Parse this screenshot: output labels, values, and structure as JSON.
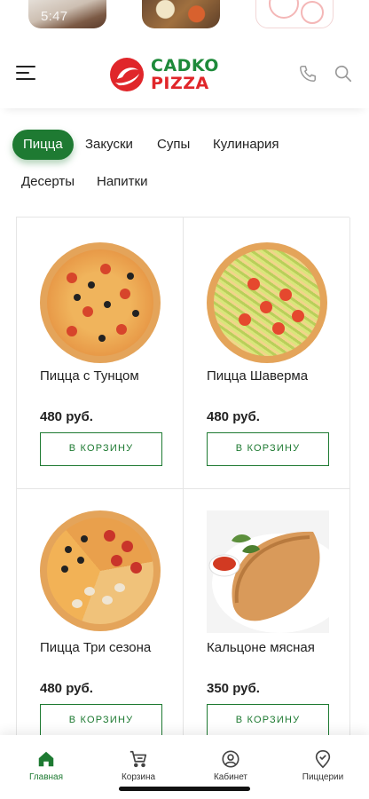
{
  "status_bar": {
    "time": "5:47"
  },
  "header": {
    "menu_icon": "hamburger-menu-icon",
    "logo_line1": "CADKO",
    "logo_line2": "PIZZA",
    "phone_icon": "phone-icon",
    "search_icon": "search-icon",
    "colors": {
      "brand_green": "#1e8a3a",
      "brand_red": "#e0262a"
    }
  },
  "categories": [
    {
      "label": "Пицца",
      "active": true
    },
    {
      "label": "Закуски",
      "active": false
    },
    {
      "label": "Супы",
      "active": false
    },
    {
      "label": "Кулинария",
      "active": false
    },
    {
      "label": "Десерты",
      "active": false
    },
    {
      "label": "Напитки",
      "active": false
    }
  ],
  "products": [
    {
      "name": "Пицца с Тунцом",
      "price": "480 руб.",
      "button": "В КОРЗИНУ"
    },
    {
      "name": "Пицца Шаверма",
      "price": "480 руб.",
      "button": "В КОРЗИНУ"
    },
    {
      "name": "Пицца Три сезона",
      "price": "480 руб.",
      "button": "В КОРЗИНУ"
    },
    {
      "name": "Кальцоне мясная",
      "price": "350 руб.",
      "button": "В КОРЗИНУ"
    }
  ],
  "bottom_nav": [
    {
      "label": "Главная",
      "icon": "home-icon",
      "active": true
    },
    {
      "label": "Корзина",
      "icon": "cart-icon",
      "active": false
    },
    {
      "label": "Кабинет",
      "icon": "account-icon",
      "active": false
    },
    {
      "label": "Пиццерии",
      "icon": "location-pin-icon",
      "active": false
    }
  ],
  "accent_color": "#1e7a32"
}
